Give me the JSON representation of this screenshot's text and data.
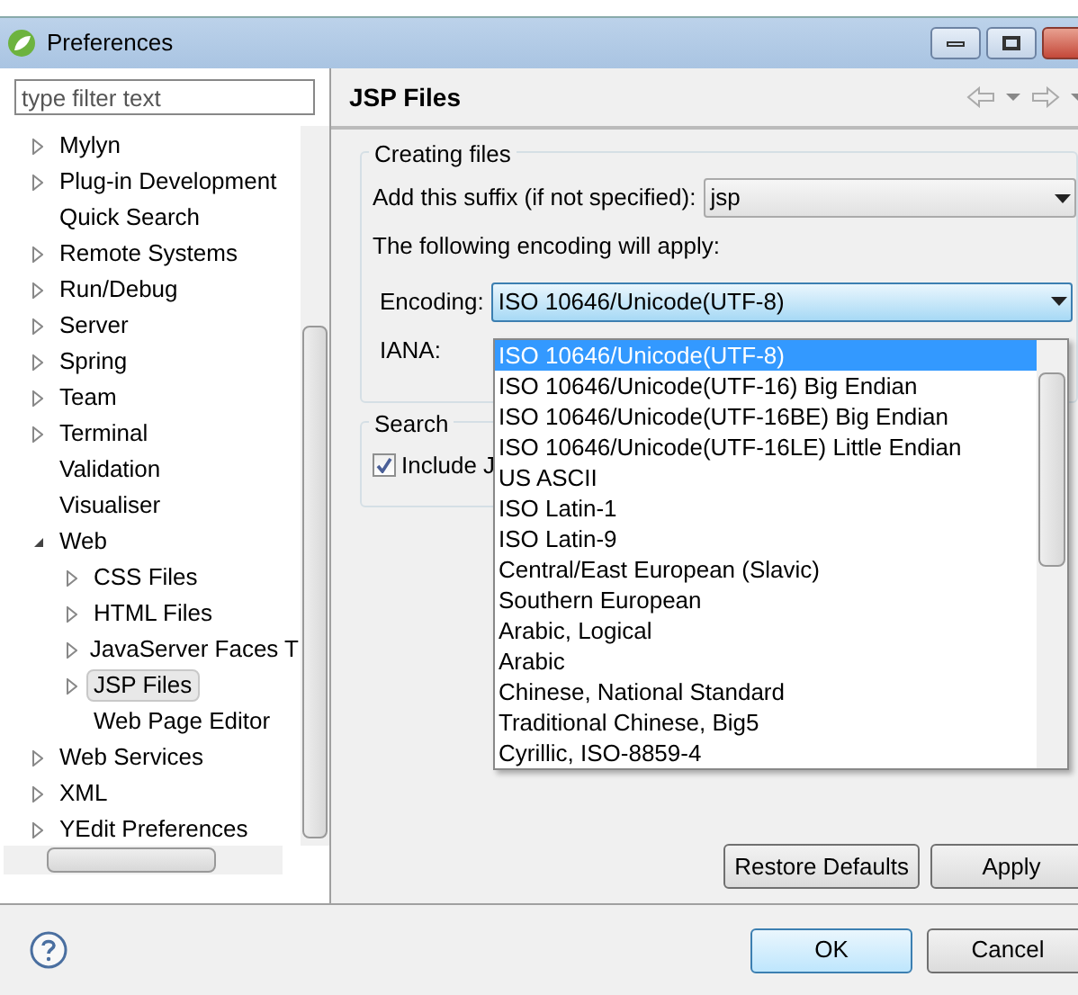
{
  "window": {
    "title": "Preferences"
  },
  "filter": {
    "placeholder": "type filter text"
  },
  "tree": [
    {
      "label": "Mylyn",
      "kind": "folder",
      "expanded": false,
      "selected": false
    },
    {
      "label": "Plug-in Development",
      "kind": "folder",
      "expanded": false,
      "selected": false
    },
    {
      "label": "Quick Search",
      "kind": "leaf",
      "selected": false
    },
    {
      "label": "Remote Systems",
      "kind": "folder",
      "expanded": false,
      "selected": false
    },
    {
      "label": "Run/Debug",
      "kind": "folder",
      "expanded": false,
      "selected": false
    },
    {
      "label": "Server",
      "kind": "folder",
      "expanded": false,
      "selected": false
    },
    {
      "label": "Spring",
      "kind": "folder",
      "expanded": false,
      "selected": false
    },
    {
      "label": "Team",
      "kind": "folder",
      "expanded": false,
      "selected": false
    },
    {
      "label": "Terminal",
      "kind": "folder",
      "expanded": false,
      "selected": false
    },
    {
      "label": "Validation",
      "kind": "leaf",
      "selected": false
    },
    {
      "label": "Visualiser",
      "kind": "leaf",
      "selected": false
    },
    {
      "label": "Web",
      "kind": "folder",
      "expanded": true,
      "selected": false,
      "children": [
        {
          "label": "CSS Files",
          "kind": "folder",
          "expanded": false,
          "selected": false
        },
        {
          "label": "HTML Files",
          "kind": "folder",
          "expanded": false,
          "selected": false
        },
        {
          "label": "JavaServer Faces T",
          "kind": "folder",
          "expanded": false,
          "selected": false
        },
        {
          "label": "JSP Files",
          "kind": "folder",
          "expanded": false,
          "selected": true
        },
        {
          "label": "Web Page Editor",
          "kind": "leaf",
          "selected": false
        }
      ]
    },
    {
      "label": "Web Services",
      "kind": "folder",
      "expanded": false,
      "selected": false
    },
    {
      "label": "XML",
      "kind": "folder",
      "expanded": false,
      "selected": false
    },
    {
      "label": "YEdit Preferences",
      "kind": "folder",
      "expanded": false,
      "selected": false
    }
  ],
  "page": {
    "title": "JSP Files"
  },
  "creating_files": {
    "title": "Creating files",
    "suffix_label": "Add this suffix (if not specified):",
    "suffix_value": "jsp",
    "encoding_note": "The following encoding will apply:",
    "encoding_label": "Encoding:",
    "encoding_value": "ISO 10646/Unicode(UTF-8)",
    "iana_label": "IANA:"
  },
  "encoding_options": [
    {
      "label": "ISO 10646/Unicode(UTF-8)",
      "selected": true
    },
    {
      "label": "ISO 10646/Unicode(UTF-16) Big Endian",
      "selected": false
    },
    {
      "label": "ISO 10646/Unicode(UTF-16BE) Big Endian",
      "selected": false
    },
    {
      "label": "ISO 10646/Unicode(UTF-16LE) Little Endian",
      "selected": false
    },
    {
      "label": "US ASCII",
      "selected": false
    },
    {
      "label": "ISO Latin-1",
      "selected": false
    },
    {
      "label": "ISO Latin-9",
      "selected": false
    },
    {
      "label": "Central/East European (Slavic)",
      "selected": false
    },
    {
      "label": "Southern European",
      "selected": false
    },
    {
      "label": "Arabic, Logical",
      "selected": false
    },
    {
      "label": "Arabic",
      "selected": false
    },
    {
      "label": "Chinese, National Standard",
      "selected": false
    },
    {
      "label": "Traditional Chinese, Big5",
      "selected": false
    },
    {
      "label": "Cyrillic, ISO-8859-4",
      "selected": false
    }
  ],
  "search": {
    "title": "Search",
    "include_label": "Include J",
    "include_checked": true
  },
  "buttons": {
    "restore": "Restore Defaults",
    "apply": "Apply",
    "ok": "OK",
    "cancel": "Cancel"
  }
}
